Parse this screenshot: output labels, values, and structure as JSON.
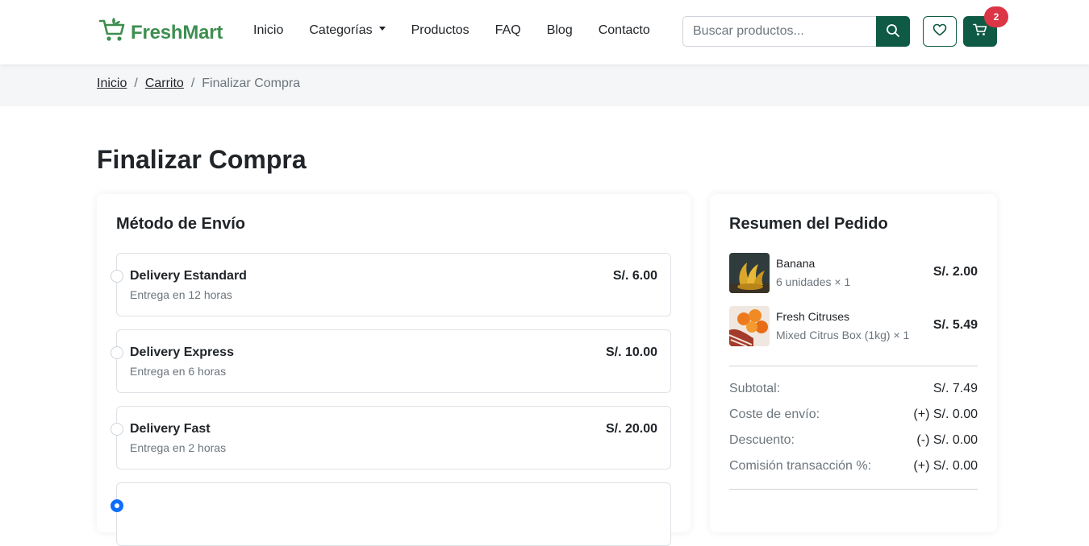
{
  "brand": {
    "name": "FreshMart",
    "color": "#3e8e50"
  },
  "nav": {
    "links": [
      "Inicio",
      "Categorías",
      "Productos",
      "FAQ",
      "Blog",
      "Contacto"
    ],
    "search_placeholder": "Buscar productos...",
    "cart_count": "2"
  },
  "breadcrumb": {
    "home": "Inicio",
    "cart": "Carrito",
    "current": "Finalizar Compra"
  },
  "page": {
    "title": "Finalizar Compra"
  },
  "shipping": {
    "title": "Método de Envío",
    "options": [
      {
        "name": "Delivery Estandard",
        "desc": "Entrega en 12 horas",
        "price": "S/. 6.00",
        "selected": false
      },
      {
        "name": "Delivery Express",
        "desc": "Entrega en 6 horas",
        "price": "S/. 10.00",
        "selected": false
      },
      {
        "name": "Delivery Fast",
        "desc": "Entrega en 2 horas",
        "price": "S/. 20.00",
        "selected": false
      },
      {
        "name": "",
        "desc": "",
        "price": "",
        "selected": true
      }
    ]
  },
  "summary": {
    "title": "Resumen del Pedido",
    "items": [
      {
        "name": "Banana",
        "sub": "6 unidades × 1",
        "price": "S/. 2.00"
      },
      {
        "name": "Fresh Citruses",
        "sub": "Mixed Citrus Box (1kg) × 1",
        "price": "S/. 5.49"
      }
    ],
    "rows": [
      {
        "label": "Subtotal:",
        "value": "S/. 7.49"
      },
      {
        "label": "Coste de envío:",
        "value": "(+) S/. 0.00"
      },
      {
        "label": "Descuento:",
        "value": "(-) S/. 0.00"
      },
      {
        "label": "Comisión transacción %:",
        "value": "(+) S/. 0.00"
      }
    ]
  },
  "colors": {
    "primary": "#0f5a45",
    "badge": "#dc3545",
    "radio_selected": "#0d6efd"
  }
}
